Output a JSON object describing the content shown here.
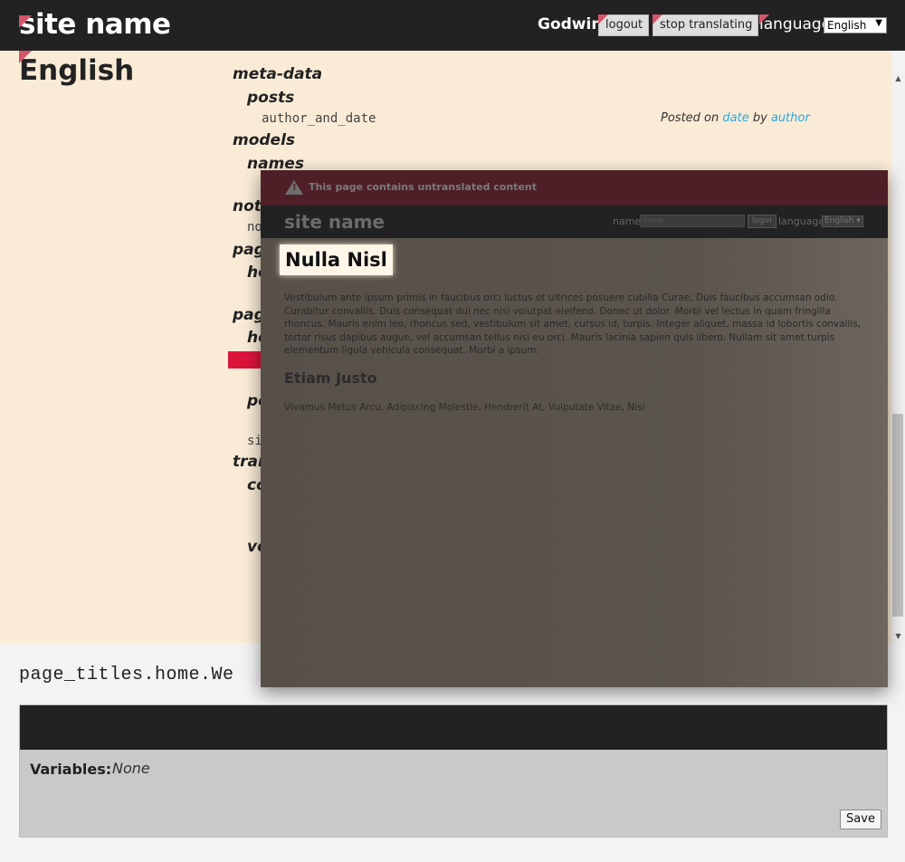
{
  "header": {
    "site_name": "site name",
    "user": "Godwin",
    "logout": "logout",
    "stop_translating": "stop translating",
    "language_label": "language",
    "language_value": "English"
  },
  "tree": {
    "heading": "English",
    "items": [
      {
        "label": "meta-data",
        "kind": "key"
      },
      {
        "label": "posts",
        "kind": "key"
      },
      {
        "label": "author_and_date",
        "kind": "leaf"
      },
      {
        "label": "models",
        "kind": "key"
      },
      {
        "label": "names",
        "kind": "key"
      },
      {
        "label": "noti",
        "kind": "key"
      },
      {
        "label": "no",
        "kind": "leaf"
      },
      {
        "label": "pag",
        "kind": "key"
      },
      {
        "label": "ho",
        "kind": "key"
      },
      {
        "label": "pag",
        "kind": "key"
      },
      {
        "label": "ho",
        "kind": "key"
      },
      {
        "label": "po",
        "kind": "key"
      },
      {
        "label": "si",
        "kind": "leaf"
      },
      {
        "label": "tran",
        "kind": "key"
      },
      {
        "label": "co",
        "kind": "key"
      },
      {
        "label": "vo",
        "kind": "key"
      }
    ],
    "preview_prefix": "Posted on",
    "preview_date": "date",
    "preview_by": "by",
    "preview_author": "author"
  },
  "editor": {
    "key_path": "page_titles.home.We",
    "variables_label": "Variables:",
    "variables_value": "None",
    "save": "Save"
  },
  "overlay": {
    "warning": "This page contains untranslated content",
    "site_name": "site name",
    "name_label": "name",
    "name_placeholder": "name",
    "login": "login",
    "language_label": "language",
    "language_value": "English",
    "title": "Nulla Nisl",
    "body": "Vestibulum ante ipsum primis in faucibus orci luctus et ultrices posuere cubilia Curae; Duis faucibus accumsan odio. Curabitur convallis. Duis consequat dui nec nisi volutpat eleifend. Donec ut dolor. Morbi vel lectus in quam fringilla rhoncus. Mauris enim leo, rhoncus sed, vestibulum sit amet, cursus id, turpis. Integer aliquet, massa id lobortis convallis, tortor risus dapibus augue, vel accumsan tellus nisi eu orci. Mauris lacinia sapien quis libero. Nullam sit amet turpis elementum ligula vehicula consequat. Morbi a ipsum.",
    "subtitle": "Etiam Justo",
    "subtext": "Vivamus Metus Arcu, Adipiscing Molestie, Hendrerit At, Vulputate Vitae, Nisl"
  },
  "colors": {
    "topbar": "#222222",
    "tree_bg": "#f9ebd6",
    "link": "#2aa8e0",
    "highlight": "#dc143c",
    "warning_bar": "#4e1f27"
  }
}
